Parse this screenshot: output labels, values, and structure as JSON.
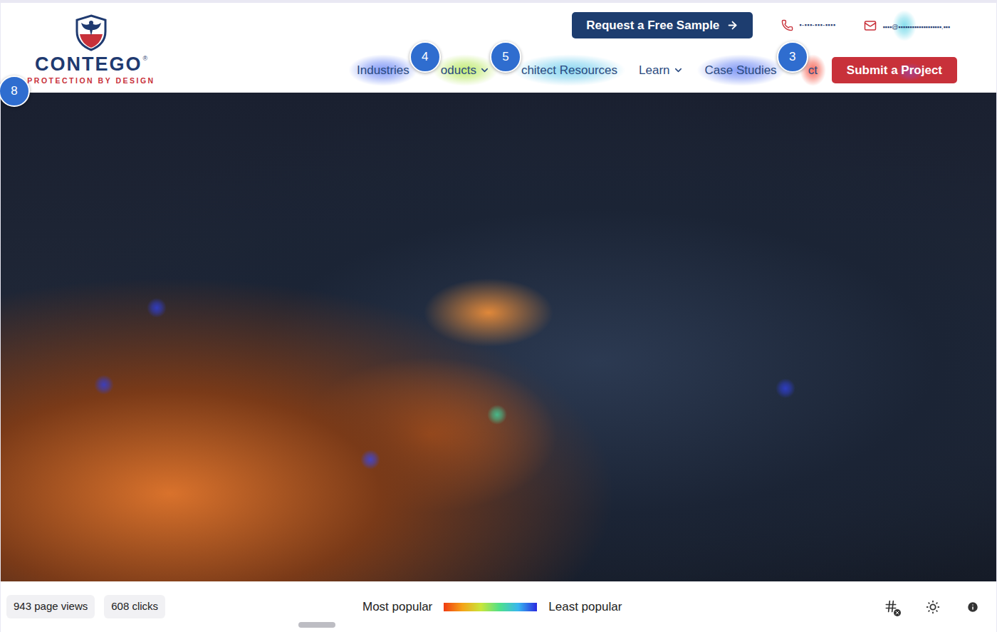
{
  "header": {
    "logo": {
      "name": "CONTEGO",
      "mark": "®",
      "tagline": "PROTECTION BY DESIGN"
    },
    "sample_button": "Request a Free Sample",
    "phone": "▪-▪▪▪-▪▪▪-▪▪▪▪",
    "email": {
      "text": "▪▪▪▪@▪▪▪▪▪▪▪▪▪▪▪▪▪▪▪▪▪▪▪.▪▪▪",
      "color": "#35c8e0"
    },
    "nav": [
      {
        "label": "Industries",
        "dropdown": false,
        "color": "#4d6ef2"
      },
      {
        "label": "oducts",
        "dropdown": true,
        "badge": "4",
        "color": "#a8e23c"
      },
      {
        "label": "chitect Resources",
        "dropdown": false,
        "badge": "5",
        "color": "#58c4ea"
      },
      {
        "label": "Learn",
        "dropdown": true
      },
      {
        "label": "Case Studies",
        "dropdown": false,
        "color": "#4d6ef2"
      },
      {
        "label": "ct",
        "dropdown": false,
        "badge": "3",
        "color": "#f2301c"
      }
    ],
    "submit_button": {
      "label": "Submit a Project",
      "color": "#8a4fd8"
    }
  },
  "hero": {
    "badge": "8",
    "hotspots": [
      {
        "color": "#3040e0"
      },
      {
        "color": "#3040e0"
      },
      {
        "color": "#3fd6a0"
      },
      {
        "color": "#3a48e8"
      },
      {
        "color": "#3040e0"
      }
    ]
  },
  "footer": {
    "page_views": "943 page views",
    "clicks": "608 clicks",
    "legend": {
      "high": "Most popular",
      "low": "Least popular"
    }
  }
}
